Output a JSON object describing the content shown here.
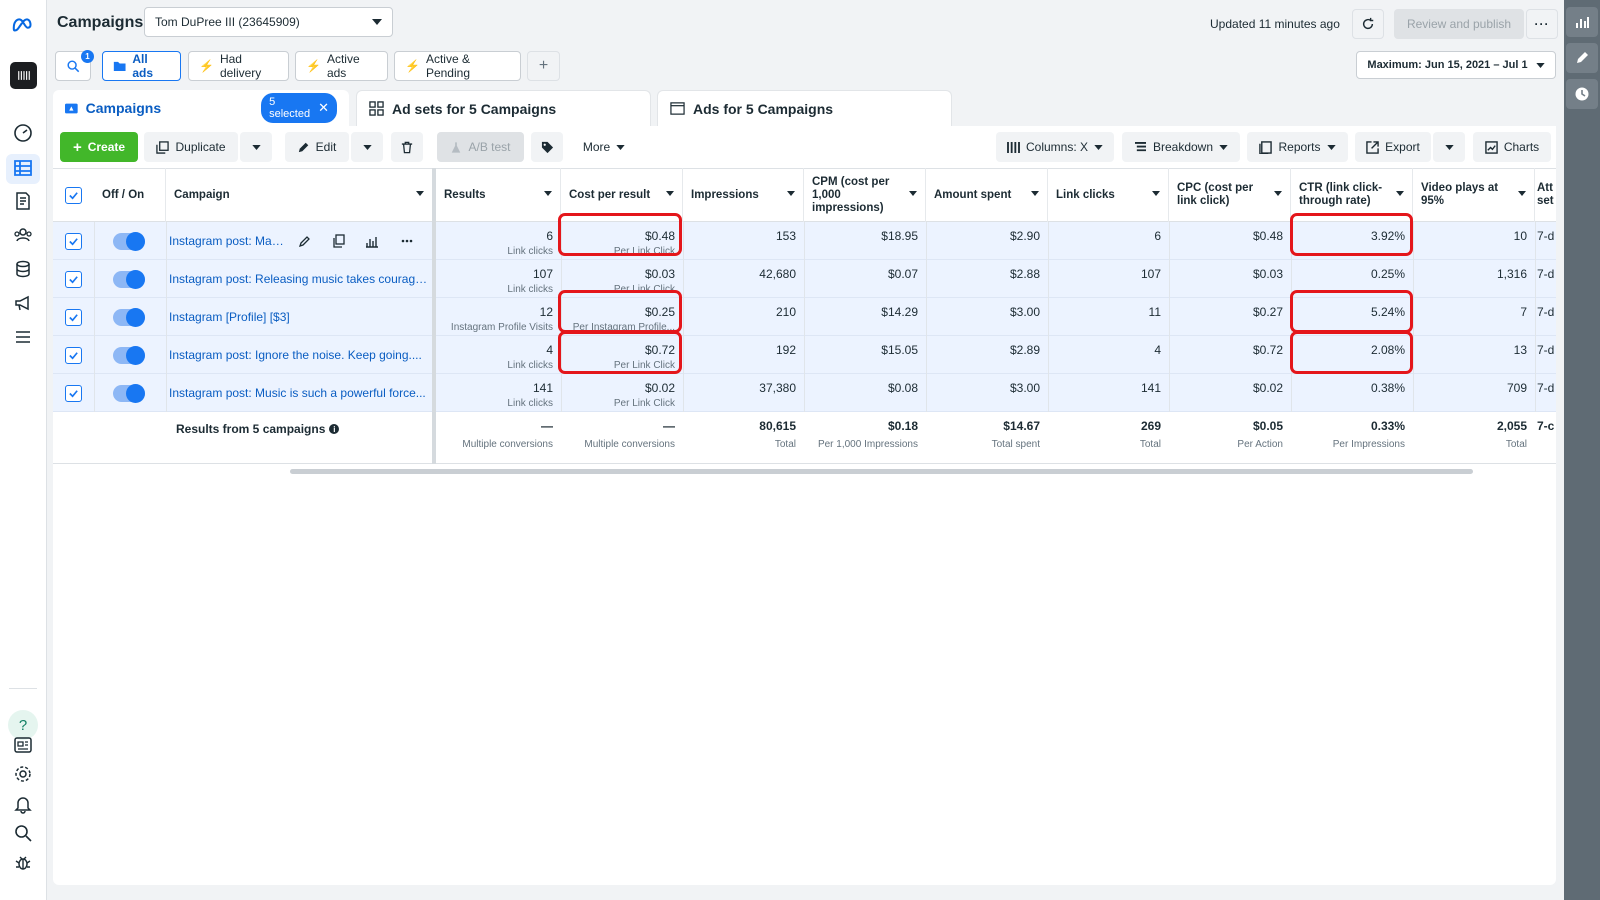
{
  "app": {
    "title": "Campaigns",
    "account": "Tom DuPree III (23645909)",
    "updated": "Updated 11 minutes ago",
    "review_label": "Review and publish",
    "date_range": "Maximum: Jun 15, 2021 – Jul 1"
  },
  "filters": {
    "search_badge": "1",
    "chips": [
      "All ads",
      "Had delivery",
      "Active ads",
      "Active & Pending"
    ]
  },
  "tabs": {
    "campaigns": "Campaigns",
    "selected": "5 selected",
    "adsets": "Ad sets for 5 Campaigns",
    "ads": "Ads for 5 Campaigns"
  },
  "toolbar": {
    "create": "Create",
    "duplicate": "Duplicate",
    "edit": "Edit",
    "ab_test": "A/B test",
    "more": "More",
    "columns": "Columns: X",
    "breakdown": "Breakdown",
    "reports": "Reports",
    "export": "Export",
    "charts": "Charts"
  },
  "columns": {
    "offon": "Off / On",
    "campaign": "Campaign",
    "results": "Results",
    "cpr": "Cost per result",
    "impressions": "Impressions",
    "cpm": "CPM (cost per 1,000 impressions)",
    "amount": "Amount spent",
    "clicks": "Link clicks",
    "cpc": "CPC (cost per link click)",
    "ctr": "CTR (link click-through rate)",
    "video": "Video plays at 95%",
    "attr": "Att set"
  },
  "rows": [
    {
      "campaign": "Instagram post: Mak...",
      "results": "6",
      "results_sub": "Link clicks",
      "cpr": "$0.48",
      "cpr_sub": "Per Link Click",
      "impressions": "153",
      "cpm": "$18.95",
      "amount": "$2.90",
      "clicks": "6",
      "cpc": "$0.48",
      "ctr": "3.92%",
      "video": "10",
      "attr": "7-d"
    },
    {
      "campaign": "Instagram post: Releasing music takes courage....",
      "results": "107",
      "results_sub": "Link clicks",
      "cpr": "$0.03",
      "cpr_sub": "Per Link Click",
      "impressions": "42,680",
      "cpm": "$0.07",
      "amount": "$2.88",
      "clicks": "107",
      "cpc": "$0.03",
      "ctr": "0.25%",
      "video": "1,316",
      "attr": "7-d"
    },
    {
      "campaign": "Instagram [Profile] [$3]",
      "results": "12",
      "results_sub": "Instagram Profile Visits",
      "cpr": "$0.25",
      "cpr_sub": "Per Instagram Profile...",
      "impressions": "210",
      "cpm": "$14.29",
      "amount": "$3.00",
      "clicks": "11",
      "cpc": "$0.27",
      "ctr": "5.24%",
      "video": "7",
      "attr": "7-d"
    },
    {
      "campaign": "Instagram post: Ignore the noise. Keep going....",
      "results": "4",
      "results_sub": "Link clicks",
      "cpr": "$0.72",
      "cpr_sub": "Per Link Click",
      "impressions": "192",
      "cpm": "$15.05",
      "amount": "$2.89",
      "clicks": "4",
      "cpc": "$0.72",
      "ctr": "2.08%",
      "video": "13",
      "attr": "7-d"
    },
    {
      "campaign": "Instagram post: Music is such a powerful force...",
      "results": "141",
      "results_sub": "Link clicks",
      "cpr": "$0.02",
      "cpr_sub": "Per Link Click",
      "impressions": "37,380",
      "cpm": "$0.08",
      "amount": "$3.00",
      "clicks": "141",
      "cpc": "$0.02",
      "ctr": "0.38%",
      "video": "709",
      "attr": "7-d"
    }
  ],
  "totals": {
    "label": "Results from 5 campaigns",
    "results": "—",
    "results_sub": "Multiple conversions",
    "cpr": "—",
    "cpr_sub": "Multiple conversions",
    "impressions": "80,615",
    "impressions_sub": "Total",
    "cpm": "$0.18",
    "cpm_sub": "Per 1,000 Impressions",
    "amount": "$14.67",
    "amount_sub": "Total spent",
    "clicks": "269",
    "clicks_sub": "Total",
    "cpc": "$0.05",
    "cpc_sub": "Per Action",
    "ctr": "0.33%",
    "ctr_sub": "Per Impressions",
    "video": "2,055",
    "video_sub": "Total",
    "attr": "7-c"
  },
  "colors": {
    "accent": "#1877f2",
    "create": "#42b72a",
    "highlight": "#e4161b"
  }
}
